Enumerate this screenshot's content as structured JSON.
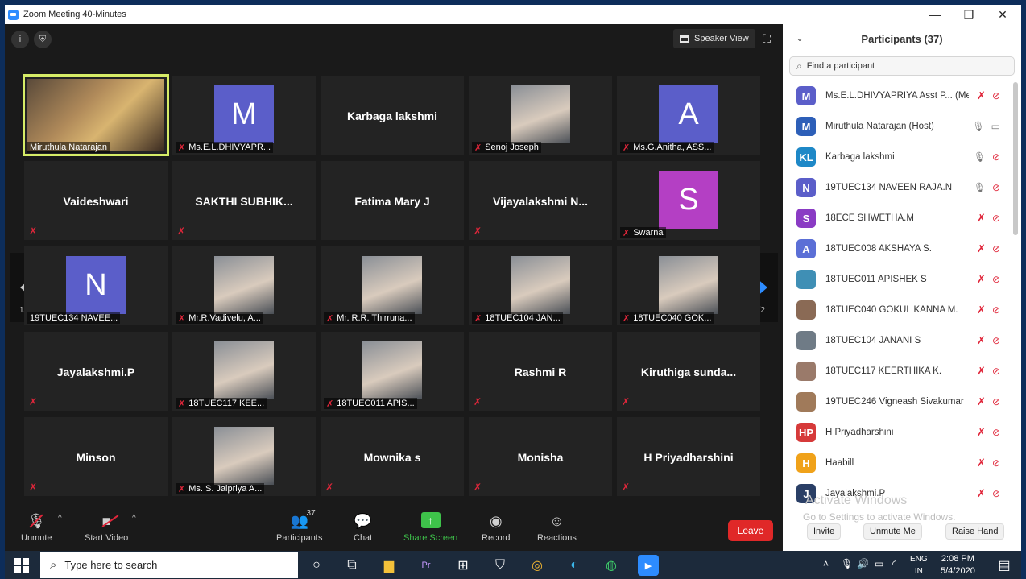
{
  "window": {
    "title": "Zoom Meeting 40-Minutes",
    "controls": {
      "minimize": "—",
      "restore": "❐",
      "close": "✕"
    }
  },
  "video": {
    "speaker_view_label": "Speaker View",
    "page_indicator_left": "1/2",
    "page_indicator_right": "1/2",
    "tiles": [
      {
        "name": "Miruthula Natarajan",
        "kind": "photo",
        "active": true,
        "mic_muted": false
      },
      {
        "name": "Ms.E.L.DHIVYAPR...",
        "kind": "avatar",
        "letter": "M",
        "color": "#5b5ec9",
        "mic_muted": true
      },
      {
        "name": "Karbaga lakshmi",
        "kind": "name",
        "mic_muted": false
      },
      {
        "name": "Senoj Joseph",
        "kind": "photo",
        "mic_muted": true
      },
      {
        "name": "Ms.G.Anitha, ASS...",
        "kind": "avatar",
        "letter": "A",
        "color": "#5b5ec9",
        "mic_muted": true
      },
      {
        "name": "Vaideshwari",
        "kind": "name",
        "mic_muted": true
      },
      {
        "name": "SAKTHI  SUBHIK...",
        "kind": "name",
        "mic_muted": true
      },
      {
        "name": "Fatima Mary J",
        "kind": "name",
        "mic_muted": false
      },
      {
        "name": "Vijayalakshmi  N...",
        "kind": "name",
        "mic_muted": true
      },
      {
        "name": "Swarna",
        "kind": "avatar",
        "letter": "S",
        "color": "#b43fc4",
        "mic_muted": true
      },
      {
        "name": "19TUEC134 NAVEE...",
        "kind": "avatar",
        "letter": "N",
        "color": "#5b5ec9",
        "mic_muted": false
      },
      {
        "name": "Mr.R.Vadivelu, A...",
        "kind": "photo",
        "mic_muted": true
      },
      {
        "name": "Mr. R.R. Thirruna...",
        "kind": "photo",
        "mic_muted": true
      },
      {
        "name": "18TUEC104 JAN...",
        "kind": "photo",
        "mic_muted": true
      },
      {
        "name": "18TUEC040 GOK...",
        "kind": "photo",
        "mic_muted": true
      },
      {
        "name": "Jayalakshmi.P",
        "kind": "name",
        "mic_muted": true
      },
      {
        "name": "18TUEC117 KEE...",
        "kind": "photo",
        "mic_muted": true
      },
      {
        "name": "18TUEC011 APIS...",
        "kind": "photo",
        "mic_muted": true
      },
      {
        "name": "Rashmi R",
        "kind": "name",
        "mic_muted": true
      },
      {
        "name": "Kiruthiga  sunda...",
        "kind": "name",
        "mic_muted": true
      },
      {
        "name": "Minson",
        "kind": "name",
        "mic_muted": true
      },
      {
        "name": "Ms. S. Jaipriya A...",
        "kind": "photo",
        "mic_muted": true
      },
      {
        "name": "Mownika s",
        "kind": "name",
        "mic_muted": true
      },
      {
        "name": "Monisha",
        "kind": "name",
        "mic_muted": true
      },
      {
        "name": "H Priyadharshini",
        "kind": "name",
        "mic_muted": true
      }
    ]
  },
  "toolbar": {
    "unmute": "Unmute",
    "start_video": "Start Video",
    "participants": "Participants",
    "participants_count": "37",
    "chat": "Chat",
    "share_screen": "Share Screen",
    "record": "Record",
    "reactions": "Reactions",
    "leave": "Leave"
  },
  "panel": {
    "title": "Participants (37)",
    "search_placeholder": "Find a participant",
    "participants": [
      {
        "name": "Ms.E.L.DHIVYAPRIYA Asst P... (Me)",
        "initials": "M",
        "color": "#5b5ec9",
        "mic": "off",
        "cam": "off"
      },
      {
        "name": "Miruthula Natarajan (Host)",
        "initials": "M",
        "color": "#2d5fb8",
        "mic": "on",
        "cam": "on"
      },
      {
        "name": "Karbaga lakshmi",
        "initials": "KL",
        "color": "#1e88c7",
        "mic": "on",
        "cam": "off"
      },
      {
        "name": "19TUEC134 NAVEEN RAJA.N",
        "initials": "N",
        "color": "#5b5ec9",
        "mic": "on",
        "cam": "off"
      },
      {
        "name": "18ECE SHWETHA.M",
        "initials": "S",
        "color": "#8a3bc4",
        "mic": "off",
        "cam": "off"
      },
      {
        "name": "18TUEC008 AKSHAYA S.",
        "initials": "A",
        "color": "#5b6fd6",
        "mic": "off",
        "cam": "off"
      },
      {
        "name": "18TUEC011 APISHEK S",
        "initials": "",
        "color": "#3f8fb5",
        "mic": "off",
        "cam": "off"
      },
      {
        "name": "18TUEC040 GOKUL KANNA M.",
        "initials": "",
        "color": "#8a6a55",
        "mic": "off",
        "cam": "off"
      },
      {
        "name": "18TUEC104 JANANI S",
        "initials": "",
        "color": "#6f7b86",
        "mic": "off",
        "cam": "off"
      },
      {
        "name": "18TUEC117 KEERTHIKA K.",
        "initials": "",
        "color": "#9a7a6a",
        "mic": "off",
        "cam": "off"
      },
      {
        "name": "19TUEC246 Vigneash Sivakumar",
        "initials": "",
        "color": "#a07a5a",
        "mic": "off",
        "cam": "off"
      },
      {
        "name": "H Priyadharshini",
        "initials": "HP",
        "color": "#d63a3a",
        "mic": "off",
        "cam": "off"
      },
      {
        "name": "Haabill",
        "initials": "H",
        "color": "#f0a21a",
        "mic": "off",
        "cam": "off"
      },
      {
        "name": "Jayalakshmi.P",
        "initials": "J",
        "color": "#2a3f66",
        "mic": "off",
        "cam": "off"
      }
    ],
    "watermark_title": "Activate Windows",
    "watermark_sub": "Go to Settings to activate Windows.",
    "invite": "Invite",
    "unmute_me": "Unmute Me",
    "raise_hand": "Raise Hand"
  },
  "taskbar": {
    "search_placeholder": "Type here to search",
    "lang_top": "ENG",
    "lang_bottom": "IN",
    "time": "2:08 PM",
    "date": "5/4/2020"
  }
}
